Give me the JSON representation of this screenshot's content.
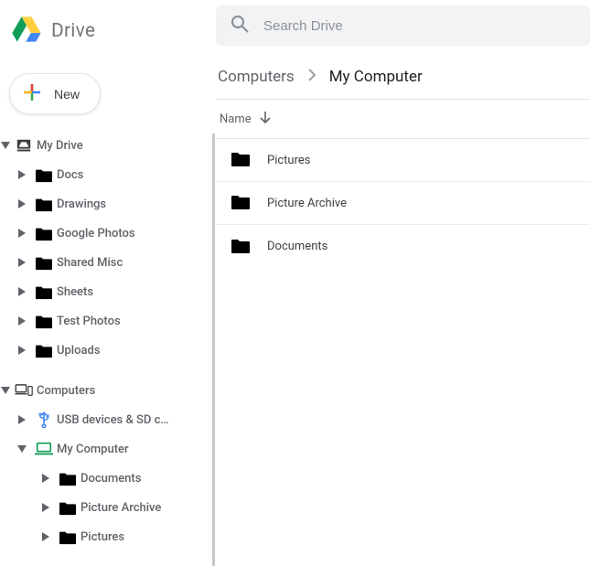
{
  "brand": {
    "name": "Drive"
  },
  "new_button": {
    "label": "New"
  },
  "search": {
    "placeholder": "Search Drive"
  },
  "tree": {
    "mydrive": {
      "label": "My Drive",
      "children": [
        {
          "label": "Docs"
        },
        {
          "label": "Drawings"
        },
        {
          "label": "Google Photos"
        },
        {
          "label": "Shared Misc"
        },
        {
          "label": "Sheets"
        },
        {
          "label": "Test Photos"
        },
        {
          "label": "Uploads"
        }
      ]
    },
    "computers": {
      "label": "Computers",
      "children": [
        {
          "label": "USB devices & SD c…",
          "icon": "usb"
        },
        {
          "label": "My Computer",
          "icon": "laptop",
          "children": [
            {
              "label": "Documents"
            },
            {
              "label": "Picture Archive"
            },
            {
              "label": "Pictures"
            }
          ]
        }
      ]
    }
  },
  "breadcrumb": {
    "root": "Computers",
    "current": "My Computer"
  },
  "columns": {
    "name": "Name"
  },
  "files": [
    {
      "name": "Pictures"
    },
    {
      "name": "Picture Archive"
    },
    {
      "name": "Documents"
    }
  ]
}
